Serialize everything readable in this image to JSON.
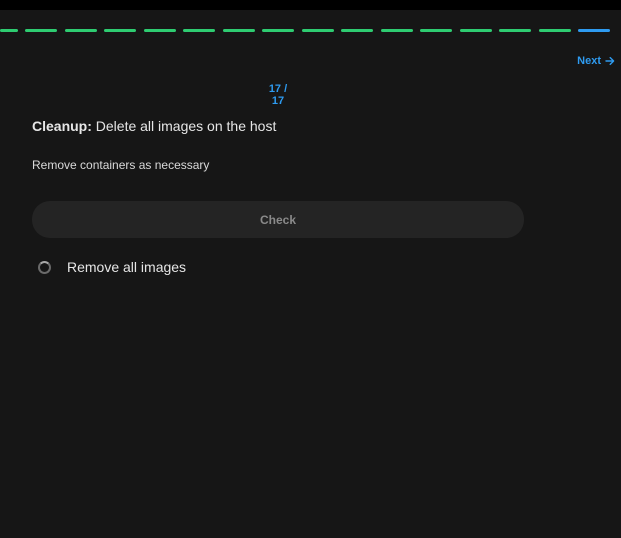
{
  "progress": {
    "total_steps": 17,
    "current_step": 17,
    "done_color": "#2ecc71",
    "current_color": "#2e9bf0"
  },
  "nav": {
    "next_label": "Next",
    "next_icon": "arrow-right-icon"
  },
  "counter": {
    "text": "17 / 17"
  },
  "task": {
    "title_label": "Cleanup:",
    "title_text": " Delete all images on the host",
    "description": "Remove containers as necessary",
    "check_button_label": "Check",
    "checks": [
      {
        "label": "Remove all images",
        "status_icon": "pending-ring-icon"
      }
    ]
  }
}
